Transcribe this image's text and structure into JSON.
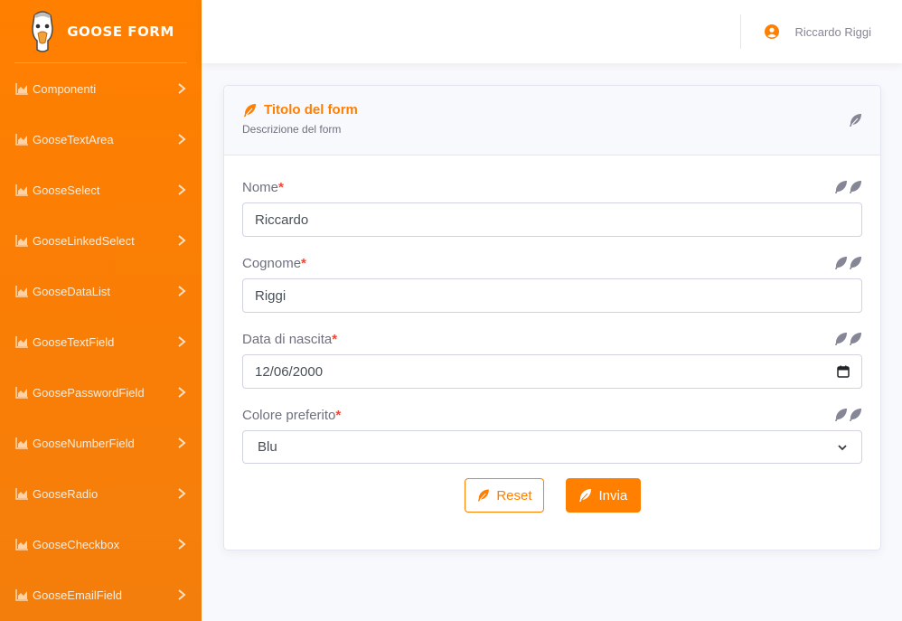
{
  "brand": {
    "name": "GOOSE FORM",
    "color": "#ff7f00"
  },
  "sidebar": {
    "items": [
      {
        "label": "Componenti"
      },
      {
        "label": "GooseTextArea"
      },
      {
        "label": "GooseSelect"
      },
      {
        "label": "GooseLinkedSelect"
      },
      {
        "label": "GooseDataList"
      },
      {
        "label": "GooseTextField"
      },
      {
        "label": "GoosePasswordField"
      },
      {
        "label": "GooseNumberField"
      },
      {
        "label": "GooseRadio"
      },
      {
        "label": "GooseCheckbox"
      },
      {
        "label": "GooseEmailField"
      }
    ]
  },
  "topbar": {
    "user_name": "Riccardo Riggi"
  },
  "form": {
    "title": "Titolo del form",
    "description": "Descrizione del form",
    "fields": [
      {
        "label": "Nome",
        "required_mark": "*",
        "value": "Riccardo"
      },
      {
        "label": "Cognome",
        "required_mark": "*",
        "value": "Riggi"
      },
      {
        "label": "Data di nascita",
        "required_mark": "*",
        "value": "12/06/2000"
      },
      {
        "label": "Colore preferito",
        "required_mark": "*",
        "value": "Blu"
      }
    ],
    "reset_label": "Reset",
    "submit_label": "Invia"
  },
  "icons": {
    "nav": "chart-area-icon",
    "chevron": "chevron-right-icon",
    "feather": "feather-icon",
    "user": "user-circle-icon",
    "calendar": "calendar-icon"
  }
}
